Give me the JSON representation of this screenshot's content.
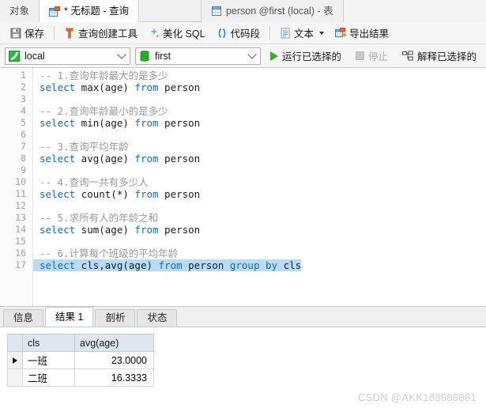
{
  "tabs": [
    {
      "label": "对象",
      "icon": "objects-icon",
      "active": false,
      "plain": true
    },
    {
      "label": "* 无标题 - 查询",
      "icon": "query-doc-icon",
      "active": true,
      "plain": false
    },
    {
      "label": "person @first (local) - 表",
      "icon": "table-icon",
      "active": false,
      "plain": true
    }
  ],
  "toolbar": {
    "save_label": "保存",
    "query_builder_label": "查询创建工具",
    "beautify_label": "美化 SQL",
    "snippet_label": "代码段",
    "text_label": "文本",
    "export_label": "导出结果"
  },
  "connbar": {
    "connection_value": "local",
    "database_value": "first",
    "run_selected_label": "运行已选择的",
    "stop_label": "停止",
    "explain_selected_label": "解释已选择的"
  },
  "editor": {
    "lines": [
      {
        "n": "1",
        "segments": [
          {
            "t": "-- 1.查询年龄最大的是多少",
            "c": "cmt"
          }
        ],
        "selected": false
      },
      {
        "n": "2",
        "segments": [
          {
            "t": "select",
            "c": "kw"
          },
          {
            "t": " max(age) ",
            "c": "txt"
          },
          {
            "t": "from",
            "c": "kw"
          },
          {
            "t": " person",
            "c": "txt"
          }
        ],
        "selected": false
      },
      {
        "n": "3",
        "segments": [
          {
            "t": "",
            "c": "txt"
          }
        ],
        "selected": false
      },
      {
        "n": "4",
        "segments": [
          {
            "t": "-- 2.查询年龄最小的是多少",
            "c": "cmt"
          }
        ],
        "selected": false
      },
      {
        "n": "5",
        "segments": [
          {
            "t": "select",
            "c": "kw"
          },
          {
            "t": " min(age) ",
            "c": "txt"
          },
          {
            "t": "from",
            "c": "kw"
          },
          {
            "t": " person",
            "c": "txt"
          }
        ],
        "selected": false
      },
      {
        "n": "6",
        "segments": [
          {
            "t": "",
            "c": "txt"
          }
        ],
        "selected": false
      },
      {
        "n": "7",
        "segments": [
          {
            "t": "-- 3.查询平均年龄",
            "c": "cmt"
          }
        ],
        "selected": false
      },
      {
        "n": "8",
        "segments": [
          {
            "t": "select",
            "c": "kw"
          },
          {
            "t": " avg(age) ",
            "c": "txt"
          },
          {
            "t": "from",
            "c": "kw"
          },
          {
            "t": " person",
            "c": "txt"
          }
        ],
        "selected": false
      },
      {
        "n": "9",
        "segments": [
          {
            "t": "",
            "c": "txt"
          }
        ],
        "selected": false
      },
      {
        "n": "10",
        "segments": [
          {
            "t": "-- 4.查询一共有多少人",
            "c": "cmt"
          }
        ],
        "selected": false
      },
      {
        "n": "11",
        "segments": [
          {
            "t": "select",
            "c": "kw"
          },
          {
            "t": " count(*) ",
            "c": "txt"
          },
          {
            "t": "from",
            "c": "kw"
          },
          {
            "t": " person",
            "c": "txt"
          }
        ],
        "selected": false
      },
      {
        "n": "12",
        "segments": [
          {
            "t": "",
            "c": "txt"
          }
        ],
        "selected": false
      },
      {
        "n": "13",
        "segments": [
          {
            "t": "-- 5.求所有人的年龄之和",
            "c": "cmt"
          }
        ],
        "selected": false
      },
      {
        "n": "14",
        "segments": [
          {
            "t": "select",
            "c": "kw"
          },
          {
            "t": " sum(age) ",
            "c": "txt"
          },
          {
            "t": "from",
            "c": "kw"
          },
          {
            "t": " person",
            "c": "txt"
          }
        ],
        "selected": false
      },
      {
        "n": "15",
        "segments": [
          {
            "t": "",
            "c": "txt"
          }
        ],
        "selected": false
      },
      {
        "n": "16",
        "segments": [
          {
            "t": "-- 6.计算每个班级的平均年龄",
            "c": "cmt"
          }
        ],
        "selected": false
      },
      {
        "n": "17",
        "segments": [
          {
            "t": "select",
            "c": "kw"
          },
          {
            "t": " cls,avg(age) ",
            "c": "txt"
          },
          {
            "t": "from",
            "c": "kw"
          },
          {
            "t": " person ",
            "c": "txt"
          },
          {
            "t": "group",
            "c": "kw"
          },
          {
            "t": " ",
            "c": "txt"
          },
          {
            "t": "by",
            "c": "kw"
          },
          {
            "t": " cls",
            "c": "txt"
          }
        ],
        "selected": true
      }
    ]
  },
  "result_tabs": [
    {
      "label": "信息",
      "active": false
    },
    {
      "label": "结果 1",
      "active": true
    },
    {
      "label": "剖析",
      "active": false
    },
    {
      "label": "状态",
      "active": false
    }
  ],
  "result_grid": {
    "columns": [
      "cls",
      "avg(age)"
    ],
    "rows": [
      {
        "current": true,
        "cells": [
          "一班",
          "23.0000"
        ]
      },
      {
        "current": false,
        "cells": [
          "二班",
          "16.3333"
        ]
      }
    ]
  },
  "watermark": "CSDN @AKK188888881",
  "colors": {
    "keyword": "#1668c8",
    "comment": "#9a9a9a",
    "selection": "#b8dcf8",
    "run_green": "#3fa72f",
    "header_bg": "#dfe6ef"
  }
}
